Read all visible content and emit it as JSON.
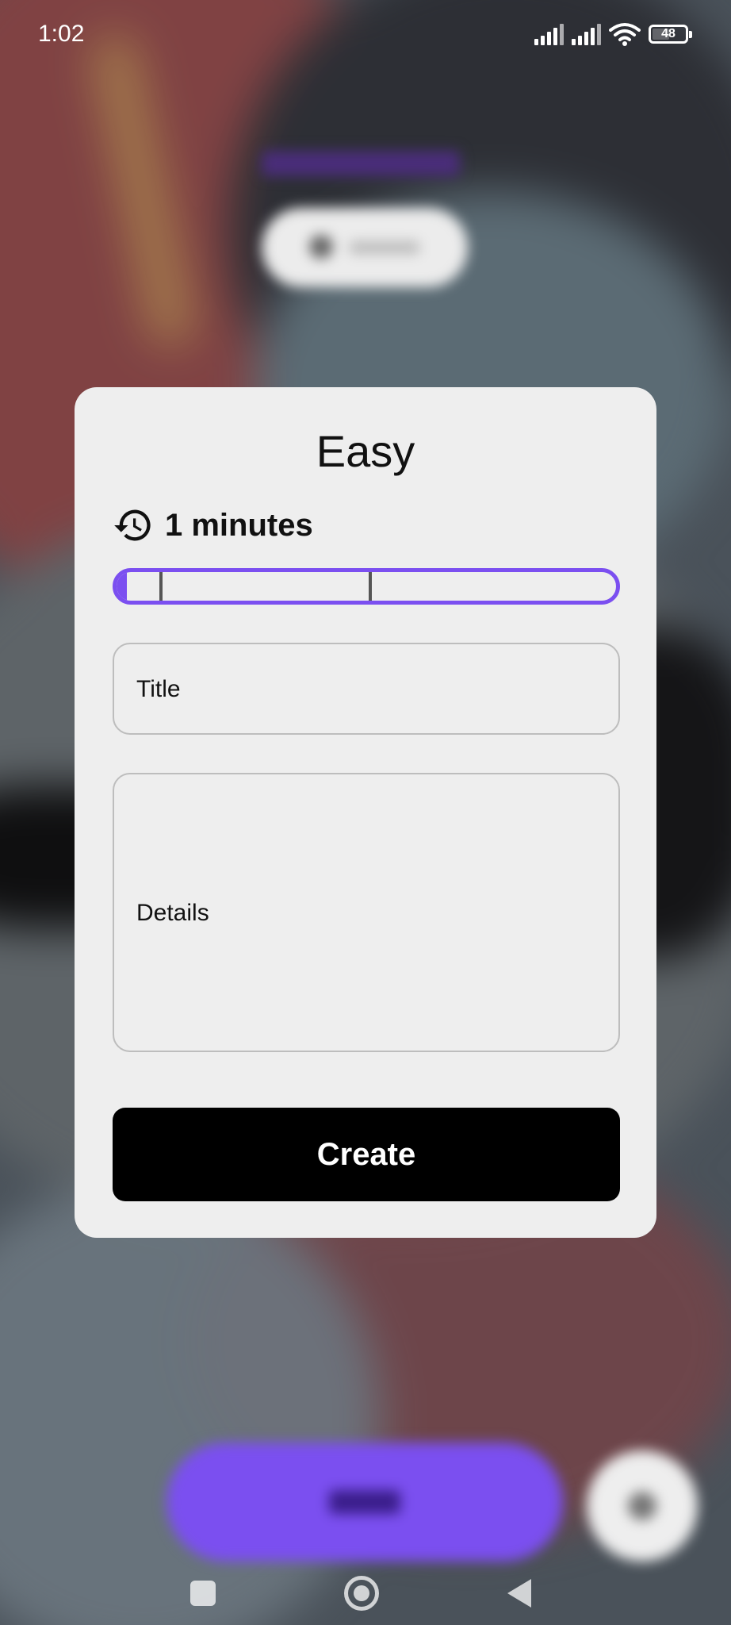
{
  "status_bar": {
    "time": "1:02",
    "battery": "48",
    "battery_fraction": 0.48
  },
  "dialog": {
    "title": "Easy",
    "duration_label": "1 minutes",
    "duration_icon": "history-icon",
    "slider_fraction": 0.02,
    "title_placeholder": "Title",
    "details_placeholder": "Details",
    "create_label": "Create"
  },
  "colors": {
    "accent": "#7b4ff0",
    "dialog_bg": "#eeeeee",
    "button_bg": "#000000"
  }
}
